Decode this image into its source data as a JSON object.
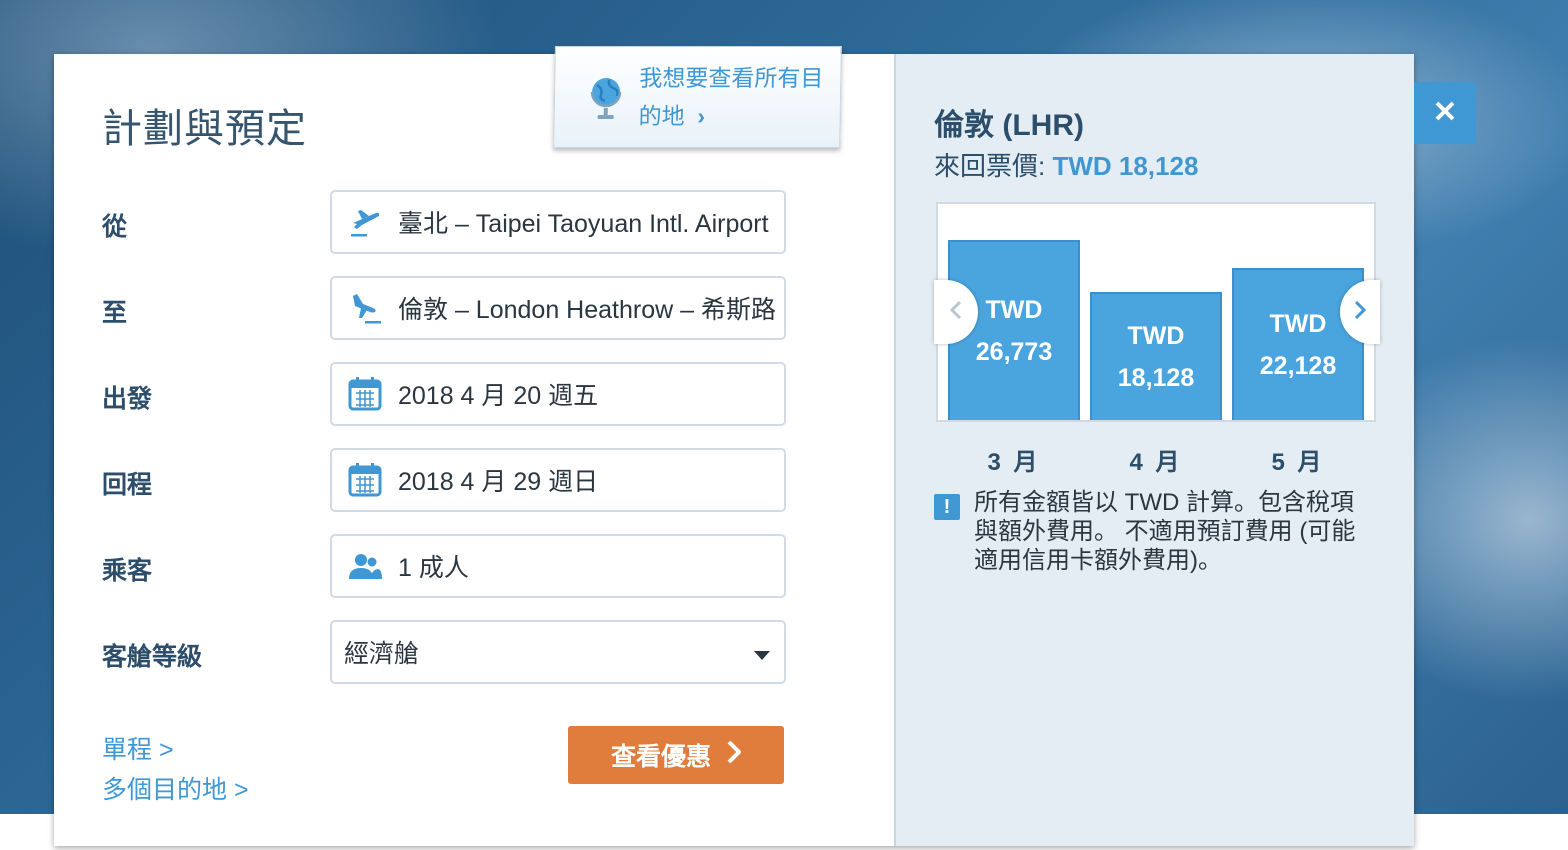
{
  "planner": {
    "title": "計劃與預定",
    "explore_link": "我想要查看所有目的地",
    "fields": [
      {
        "label": "從",
        "value": "臺北 – Taipei Taoyuan Intl. Airport",
        "icon": "plane-takeoff-icon"
      },
      {
        "label": "至",
        "value": "倫敦 – London Heathrow – 希斯路",
        "icon": "plane-landing-icon"
      },
      {
        "label": "出發",
        "value": "2018 4 月 20 週五",
        "icon": "calendar-icon"
      },
      {
        "label": "回程",
        "value": "2018 4 月 29 週日",
        "icon": "calendar-icon"
      },
      {
        "label": "乘客",
        "value": "1 成人",
        "icon": "passengers-icon"
      }
    ],
    "cabin": {
      "label": "客艙等級",
      "value": "經濟艙"
    },
    "links": {
      "one_way": "單程 >",
      "multi_city": "多個目的地 >"
    },
    "cta_label": "查看優惠"
  },
  "fares": {
    "destination": "倫敦 (LHR)",
    "price_label": "來回票價: ",
    "price_value": "TWD 18,128",
    "note": "所有金額皆以 TWD 計算。包含稅項與額外費用。 不適用預訂費用 (可能適用信用卡額外費用)。"
  },
  "chart_data": {
    "type": "bar",
    "categories": [
      "3 月",
      "4 月",
      "5 月"
    ],
    "values": [
      26773,
      18128,
      22128
    ],
    "value_labels": [
      [
        "TWD",
        "26,773"
      ],
      [
        "TWD",
        "18,128"
      ],
      [
        "TWD",
        "22,128"
      ]
    ],
    "ylim": [
      0,
      30000
    ],
    "highlight_color": "#4aa5df"
  },
  "colors": {
    "accent": "#3f97d3",
    "cta": "#e07d3c",
    "heading": "#2c4e6b"
  }
}
